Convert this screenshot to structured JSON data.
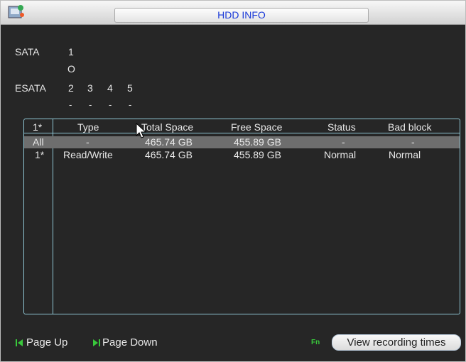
{
  "window": {
    "title": "HDD INFO"
  },
  "ports": {
    "sata_label": "SATA",
    "sata_num": "1",
    "sata_state": "O",
    "esata_label": "ESATA",
    "esata_nums": [
      "2",
      "3",
      "4",
      "5"
    ],
    "esata_states": [
      "-",
      "-",
      "-",
      "-"
    ]
  },
  "table": {
    "headers": [
      "1*",
      "Type",
      "Total Space",
      "Free Space",
      "Status",
      "Bad block"
    ],
    "rows": [
      [
        "All",
        "-",
        "465.74 GB",
        "455.89 GB",
        "-",
        "-"
      ],
      [
        "1*",
        "Read/Write",
        "465.74 GB",
        "455.89 GB",
        "Normal",
        "Normal"
      ]
    ]
  },
  "footer": {
    "page_up": "Page Up",
    "page_down": "Page Down",
    "fn": "Fn",
    "view_button": "View recording times"
  },
  "colors": {
    "title_text": "#1a3ad8",
    "accent_line": "#8fc6d4",
    "fn_green": "#39c83c"
  }
}
